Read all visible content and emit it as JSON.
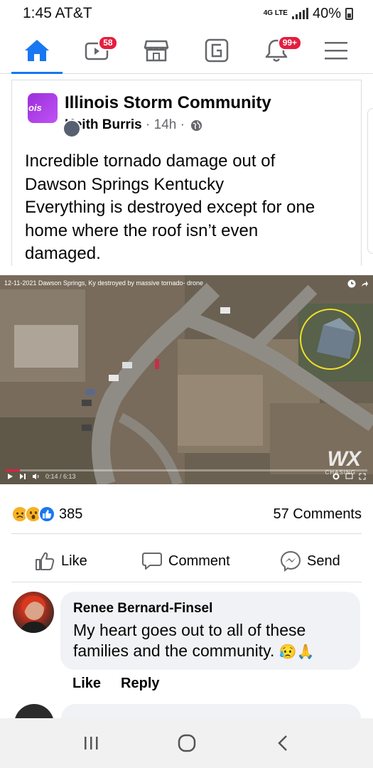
{
  "status_bar": {
    "time": "1:45 AT&T",
    "network": "4G LTE",
    "battery": "40%"
  },
  "navbar": {
    "items": [
      {
        "name": "home-icon",
        "active": true,
        "badge": ""
      },
      {
        "name": "watch-icon",
        "active": false,
        "badge": "58"
      },
      {
        "name": "marketplace-icon",
        "active": false,
        "badge": ""
      },
      {
        "name": "gaming-icon",
        "active": false,
        "badge": ""
      },
      {
        "name": "notifications-icon",
        "active": false,
        "badge": "99+"
      },
      {
        "name": "menu-icon",
        "active": false,
        "badge": ""
      }
    ]
  },
  "post": {
    "group_name": "Illinois Storm Community",
    "group_avatar_text": "ois",
    "author": "Keith Burris",
    "meta": " · 14h · ",
    "text_lines": [
      "Incredible tornado damage out of",
      "Dawson Springs Kentucky",
      "Everything is destroyed except for one",
      "home where the roof isn’t even",
      "damaged."
    ],
    "video": {
      "title": "12-11-2021 Dawson Springs, Ky destroyed by massive tornado- drone",
      "time": "0:14 / 6:13",
      "watermark": "WX",
      "watermark_sub": "CHASING",
      "progress": 0.04
    }
  },
  "reactions": {
    "count": "385",
    "comments": "57 Comments",
    "types": [
      "sad",
      "wow",
      "like"
    ]
  },
  "actions": {
    "like": "Like",
    "comment": "Comment",
    "send": "Send"
  },
  "comment": {
    "author": "Renee Bernard-Finsel",
    "text_line1": "My heart goes out to all of these",
    "text_line2": "families and the community.",
    "emojis": "😥🙏",
    "like": "Like",
    "reply": "Reply"
  },
  "colors": {
    "brand": "#1877f2",
    "badge": "#e41e3f",
    "bubble": "#f0f2f5",
    "progress": "#e41e3f"
  }
}
